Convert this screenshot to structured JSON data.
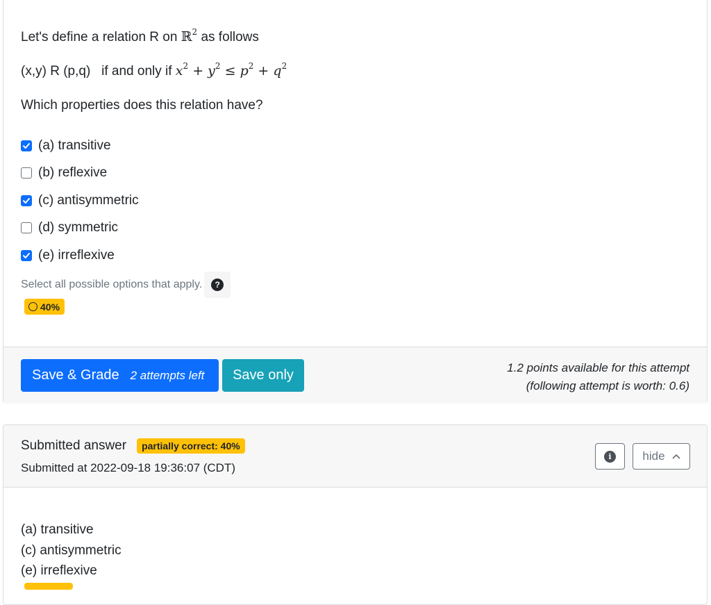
{
  "question": {
    "intro_prefix": "Let's define a relation R on",
    "intro_set": "ℝ",
    "intro_set_exp": "2",
    "intro_suffix": "as follows",
    "relation_text": "(x,y) R (p,q)   if and only if",
    "relation_math": {
      "x": "x",
      "y": "y",
      "p": "p",
      "q": "q",
      "exp": "2",
      "plus": "+",
      "leq": "≤"
    },
    "prompt": "Which properties does this relation have?",
    "options": [
      {
        "label": "(a) transitive",
        "checked": true
      },
      {
        "label": "(b) reflexive",
        "checked": false
      },
      {
        "label": "(c) antisymmetric",
        "checked": true
      },
      {
        "label": "(d) symmetric",
        "checked": false
      },
      {
        "label": "(e) irreflexive",
        "checked": true
      }
    ],
    "hint": "Select all possible options that apply.",
    "help_icon": "question-circle-icon",
    "score_badge": "40%"
  },
  "footer": {
    "save_grade_label": "Save & Grade",
    "attempts_left": "2 attempts left",
    "save_only_label": "Save only",
    "points_line1": "1.2 points available for this attempt",
    "points_line2": "(following attempt is worth: 0.6)"
  },
  "submission": {
    "title": "Submitted answer",
    "badge": "partially correct: 40%",
    "time": "Submitted at 2022-09-18 19:36:07 (CDT)",
    "info_icon": "info-circle-icon",
    "hide_label": "hide",
    "answers": [
      "(a) transitive",
      "(c) antisymmetric",
      "(e) irreflexive"
    ]
  },
  "colors": {
    "primary": "#0d6efd",
    "info": "#17a2b8",
    "warning": "#ffc107"
  }
}
